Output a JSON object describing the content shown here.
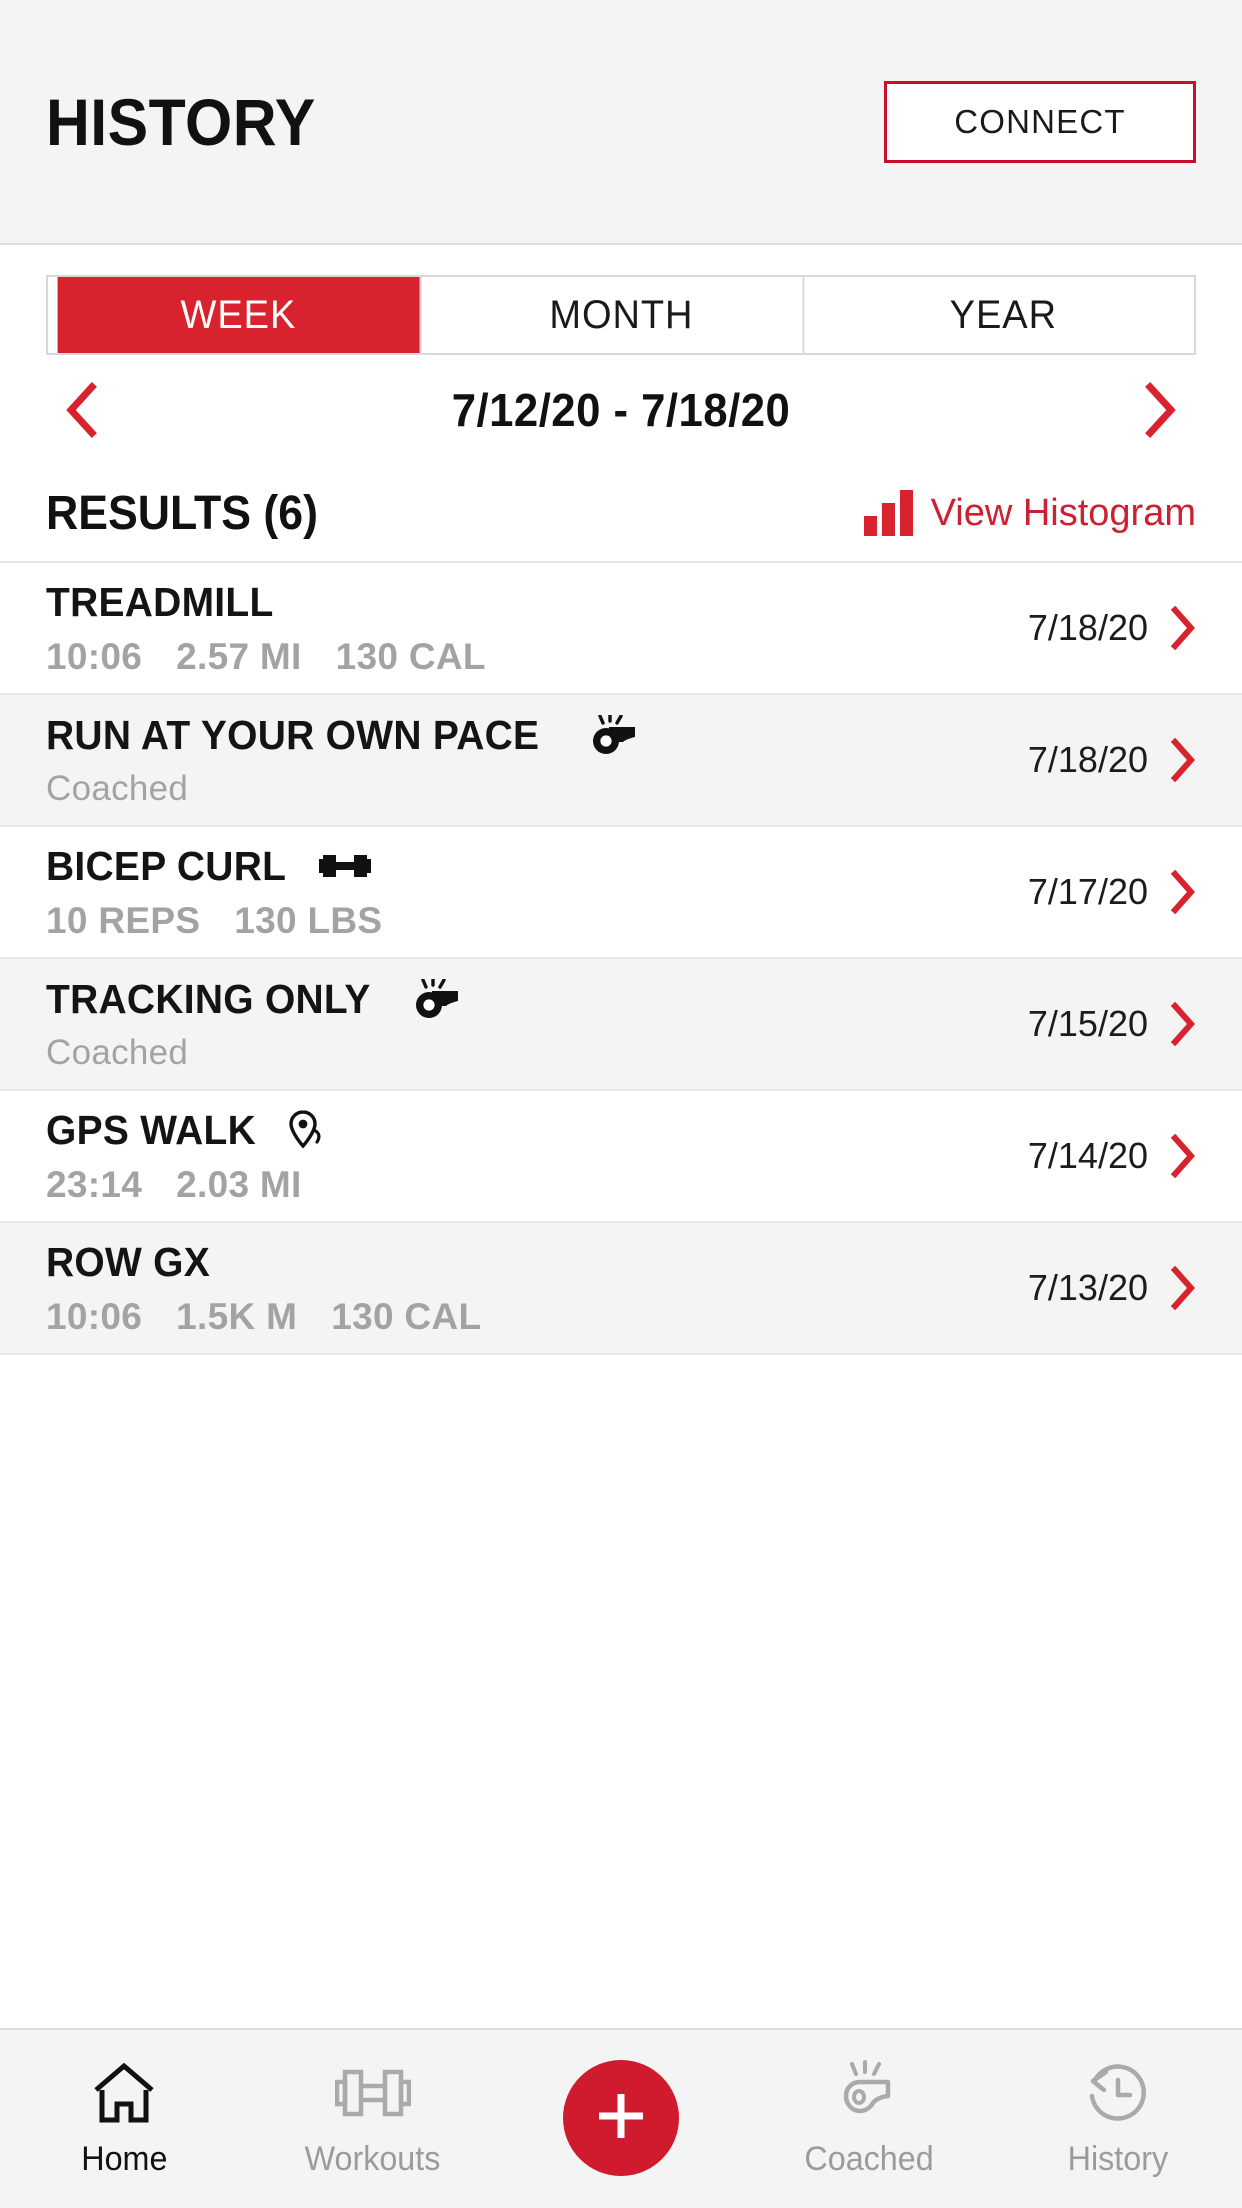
{
  "header": {
    "title": "HISTORY",
    "connect_label": "CONNECT",
    "accent_border": "#c8102e"
  },
  "tabs": {
    "items": [
      {
        "label": "WEEK",
        "active": true
      },
      {
        "label": "MONTH",
        "active": false
      },
      {
        "label": "YEAR",
        "active": false
      }
    ],
    "active_bg": "#d8232f"
  },
  "date_nav": {
    "prev_icon": "chevron-left-icon",
    "next_icon": "chevron-right-icon",
    "range": "7/12/20 - 7/18/20",
    "arrow_color": "#d8232f"
  },
  "results": {
    "title": "RESULTS (6)",
    "histogram_label": "View Histogram",
    "histogram_icon": "bar-chart-icon",
    "histogram_color": "#cc2131"
  },
  "workouts": [
    {
      "title": "TREADMILL",
      "icon": null,
      "metrics": [
        "10:06",
        "2.57 MI",
        "130 CAL"
      ],
      "subtitle": null,
      "date": "7/18/20",
      "alt": false
    },
    {
      "title": "RUN AT YOUR OWN PACE",
      "icon": "whistle-icon",
      "metrics": [],
      "subtitle": "Coached",
      "date": "7/18/20",
      "alt": true
    },
    {
      "title": "BICEP CURL",
      "icon": "dumbbell-icon",
      "metrics": [
        "10 REPS",
        "130 LBS"
      ],
      "subtitle": null,
      "date": "7/17/20",
      "alt": false
    },
    {
      "title": "TRACKING ONLY",
      "icon": "whistle-icon",
      "metrics": [],
      "subtitle": "Coached",
      "date": "7/15/20",
      "alt": true
    },
    {
      "title": "GPS WALK",
      "icon": "location-pin-icon",
      "metrics": [
        "23:14",
        "2.03 MI"
      ],
      "subtitle": null,
      "date": "7/14/20",
      "alt": false
    },
    {
      "title": "ROW GX",
      "icon": null,
      "metrics": [
        "10:06",
        "1.5K M",
        "130 CAL"
      ],
      "subtitle": null,
      "date": "7/13/20",
      "alt": true
    }
  ],
  "bottom_nav": {
    "items": [
      {
        "label": "Home",
        "icon": "home-icon",
        "active": true
      },
      {
        "label": "Workouts",
        "icon": "dumbbell-outline-icon",
        "active": false
      },
      {
        "label": "Coached",
        "icon": "whistle-outline-icon",
        "active": false
      },
      {
        "label": "History",
        "icon": "clock-history-icon",
        "active": false
      }
    ],
    "fab": {
      "icon": "plus-icon",
      "color": "#d01b2e"
    }
  }
}
